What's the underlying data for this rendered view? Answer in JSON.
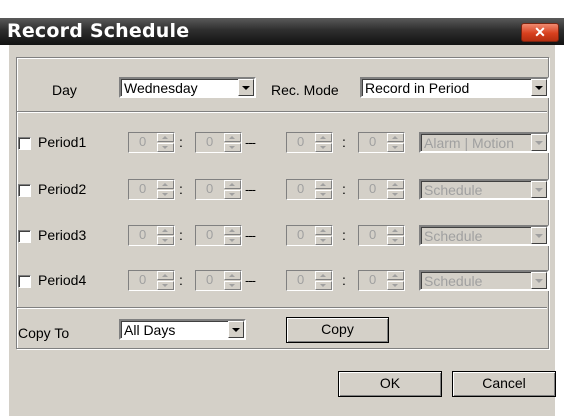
{
  "window": {
    "title": "Record Schedule",
    "close_glyph": "✕"
  },
  "day": {
    "label": "Day",
    "value": "Wednesday"
  },
  "rec_mode": {
    "label": "Rec. Mode",
    "value": "Record in Period"
  },
  "periods": [
    {
      "label": "Period1",
      "start_hour": "0",
      "start_min": "0",
      "end_hour": "0",
      "end_min": "0",
      "mode": "Alarm | Motion"
    },
    {
      "label": "Period2",
      "start_hour": "0",
      "start_min": "0",
      "end_hour": "0",
      "end_min": "0",
      "mode": "Schedule"
    },
    {
      "label": "Period3",
      "start_hour": "0",
      "start_min": "0",
      "end_hour": "0",
      "end_min": "0",
      "mode": "Schedule"
    },
    {
      "label": "Period4",
      "start_hour": "0",
      "start_min": "0",
      "end_hour": "0",
      "end_min": "0",
      "mode": "Schedule"
    }
  ],
  "time_separator": ":",
  "range_separator": "---",
  "copy_to": {
    "label": "Copy To",
    "value": "All Days",
    "button": "Copy"
  },
  "buttons": {
    "ok": "OK",
    "cancel": "Cancel"
  },
  "colors": {
    "titlebar": "#2e2e2e",
    "dialog_bg": "#d4d0c8",
    "close_button": "#d8401e",
    "disabled_text": "#a0a0a0"
  }
}
